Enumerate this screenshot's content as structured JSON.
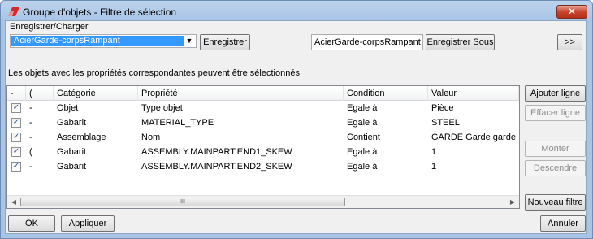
{
  "window": {
    "title": "Groupe d'objets - Filtre de sélection",
    "close_glyph": "✕"
  },
  "save_load": {
    "section_label": "Enregistrer/Charger",
    "combo_value": "AcierGarde-corpsRampant",
    "combo_arrow": "▼",
    "save_button": "Enregistrer",
    "name_field_value": "AcierGarde-corpsRampant",
    "save_as_button": "Enregistrer Sous",
    "expand_button": ">>"
  },
  "info_text": "Les objets avec les propriétés correspondantes peuvent être sélectionnés",
  "grid": {
    "columns": [
      "-",
      "(",
      "Catégorie",
      "Propriété",
      "Condition",
      "Valeur"
    ],
    "rows": [
      {
        "checked": true,
        "dash": "-",
        "paren": "",
        "category": "Objet",
        "property": "Type objet",
        "condition": "Egale à",
        "value": "Pièce"
      },
      {
        "checked": true,
        "dash": "-",
        "paren": "",
        "category": "Gabarit",
        "property": "MATERIAL_TYPE",
        "condition": "Egale à",
        "value": "STEEL"
      },
      {
        "checked": true,
        "dash": "-",
        "paren": "",
        "category": "Assemblage",
        "property": "Nom",
        "condition": "Contient",
        "value": "GARDE Garde garde"
      },
      {
        "checked": true,
        "dash": "(",
        "paren": "",
        "category": "Gabarit",
        "property": "ASSEMBLY.MAINPART.END1_SKEW",
        "condition": "Egale à",
        "value": "1"
      },
      {
        "checked": true,
        "dash": "-",
        "paren": "",
        "category": "Gabarit",
        "property": "ASSEMBLY.MAINPART.END2_SKEW",
        "condition": "Egale à",
        "value": "1"
      }
    ],
    "check_glyph": "✓",
    "scroll_left": "◀",
    "scroll_right": "▶",
    "scroll_thumb_grip": "III"
  },
  "side_buttons": {
    "add_row": "Ajouter ligne",
    "delete_row": "Effacer ligne",
    "move_up": "Monter",
    "move_down": "Descendre",
    "new_filter": "Nouveau filtre"
  },
  "bottom_buttons": {
    "ok": "OK",
    "apply": "Appliquer",
    "cancel": "Annuler"
  },
  "colors": {
    "titlebar": "#a9c5e6",
    "selection": "#3399ff",
    "close": "#c7462c"
  }
}
